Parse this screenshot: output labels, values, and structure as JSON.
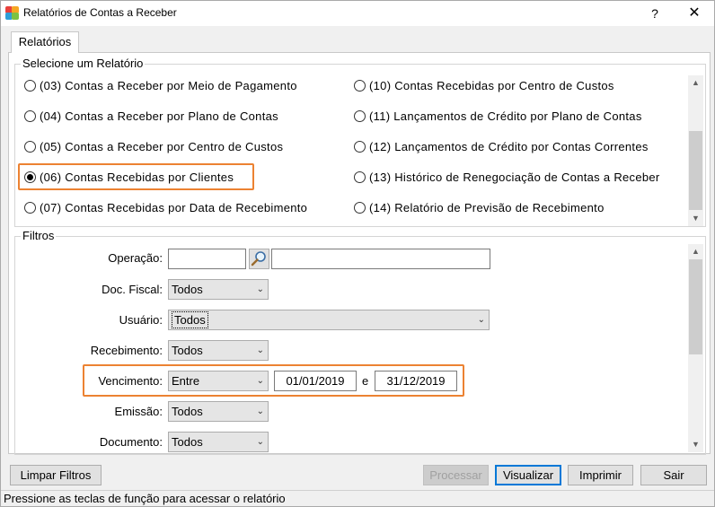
{
  "window": {
    "title": "Relatórios de Contas a Receber",
    "help_label": "?",
    "close_label": "✕"
  },
  "tab": {
    "label": "Relatórios"
  },
  "reports": {
    "legend": "Selecione um Relatório",
    "items_left": [
      {
        "label": "(03) Contas a Receber por Meio de Pagamento",
        "checked": false
      },
      {
        "label": "(04) Contas a Receber por Plano de Contas",
        "checked": false
      },
      {
        "label": "(05) Contas a Receber por Centro de Custos",
        "checked": false
      },
      {
        "label": "(06) Contas Recebidas por Clientes",
        "checked": true
      },
      {
        "label": "(07) Contas Recebidas por Data de Recebimento",
        "checked": false
      }
    ],
    "items_right": [
      {
        "label": "(10) Contas Recebidas por Centro de Custos",
        "checked": false
      },
      {
        "label": "(11) Lançamentos de Crédito por Plano de Contas",
        "checked": false
      },
      {
        "label": "(12) Lançamentos de Crédito por Contas Correntes",
        "checked": false
      },
      {
        "label": "(13) Histórico de Renegociação de Contas a Receber",
        "checked": false
      },
      {
        "label": "(14) Relatório de Previsão de Recebimento",
        "checked": false
      }
    ]
  },
  "filters": {
    "legend": "Filtros",
    "operacao": {
      "label": "Operação:",
      "code": "",
      "description": ""
    },
    "doc_fiscal": {
      "label": "Doc. Fiscal:",
      "value": "Todos"
    },
    "usuario": {
      "label": "Usuário:",
      "value": "Todos"
    },
    "recebimento": {
      "label": "Recebimento:",
      "value": "Todos"
    },
    "vencimento": {
      "label": "Vencimento:",
      "value": "Entre",
      "date_from": "01/01/2019",
      "separator": "e",
      "date_to": "31/12/2019"
    },
    "emissao": {
      "label": "Emissão:",
      "value": "Todos"
    },
    "documento": {
      "label": "Documento:",
      "value": "Todos"
    }
  },
  "buttons": {
    "clear": "Limpar Filtros",
    "process": "Processar",
    "view": "Visualizar",
    "print": "Imprimir",
    "exit": "Sair"
  },
  "status": {
    "text": "Pressione as teclas de função para acessar o relatório"
  },
  "colors": {
    "highlight": "#ec8232",
    "accent": "#0078d7"
  }
}
